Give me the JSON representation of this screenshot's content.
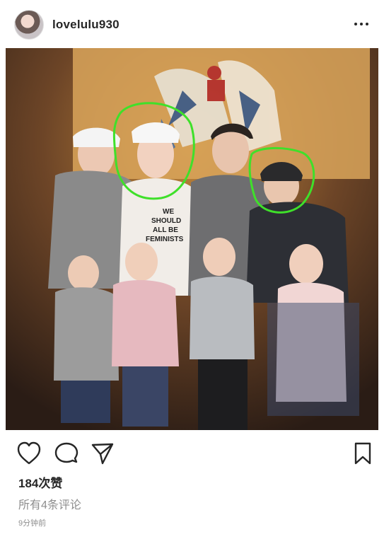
{
  "post": {
    "username": "lovelulu930",
    "more_icon": "more-horizontal-icon",
    "photo_shirt_text": [
      "WE",
      "SHOULD",
      "ALL BE",
      "FEMINISTS"
    ],
    "actions": [
      "heart-icon",
      "comment-icon",
      "share-icon",
      "bookmark-icon"
    ],
    "likes": "184次赞",
    "comments": "所有4条评论",
    "time": "9分钟前",
    "highlight_color": "#3fe02a"
  }
}
